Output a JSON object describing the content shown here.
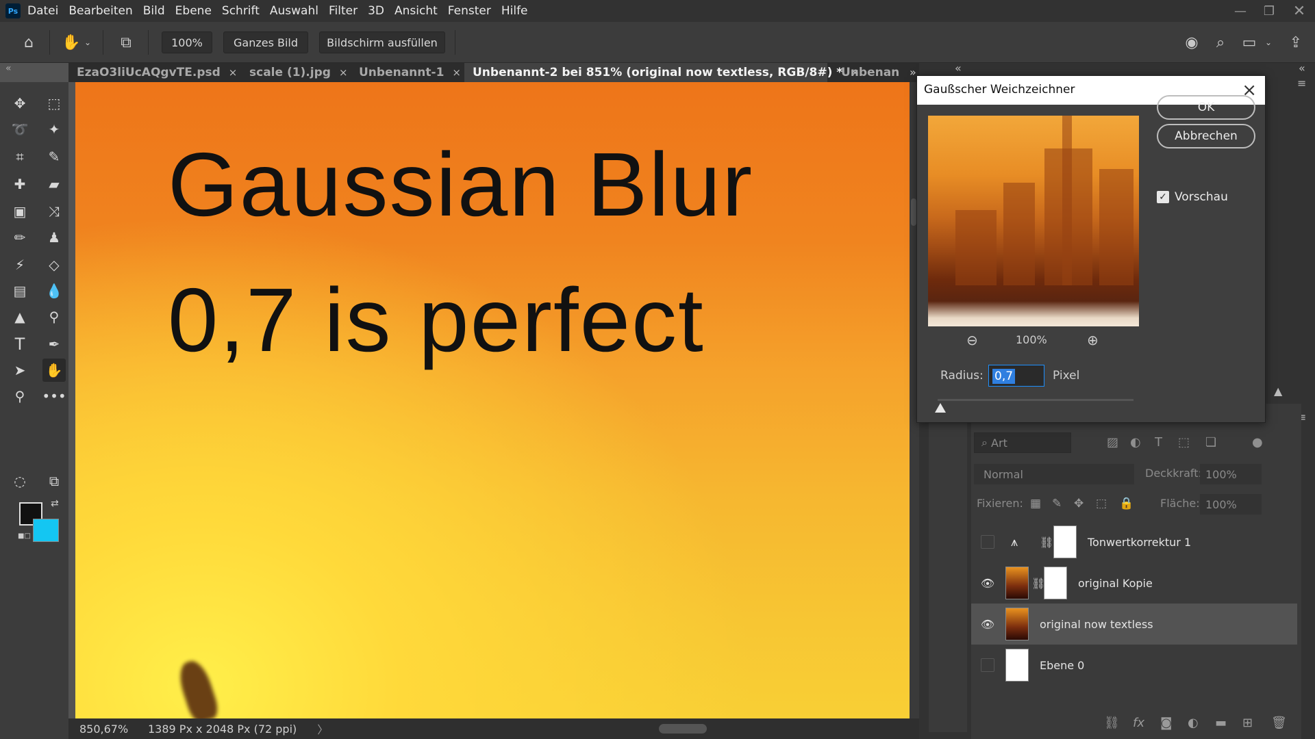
{
  "app": {
    "logo": "Ps"
  },
  "menu": [
    "Datei",
    "Bearbeiten",
    "Bild",
    "Ebene",
    "Schrift",
    "Auswahl",
    "Filter",
    "3D",
    "Ansicht",
    "Fenster",
    "Hilfe"
  ],
  "options": {
    "zoom": "100%",
    "fit_screen": "Ganzes Bild",
    "fill_screen": "Bildschirm ausfüllen"
  },
  "tabs": [
    {
      "label": "EzaO3liUcAQgvTE.psd",
      "close": "×"
    },
    {
      "label": "scale (1).jpg",
      "close": "×"
    },
    {
      "label": "Unbenannt-1",
      "close": "×"
    },
    {
      "label": "Unbenannt-2 bei 851% (original now textless, RGB/8#) *",
      "close": "×"
    },
    {
      "label": "Unbenan",
      "close": ""
    }
  ],
  "canvas": {
    "line1": "Gaussian Blur",
    "line2": "0,7 is perfect"
  },
  "status": {
    "zoom": "850,67%",
    "doc_size": "1389 Px x 2048 Px (72 ppi)",
    "arrow": "〉"
  },
  "colors": {
    "foreground": "#111111",
    "background": "#14c6f2",
    "accent": "#1e90ff"
  },
  "dialog": {
    "title": "Gaußscher Weichzeichner",
    "ok": "OK",
    "cancel": "Abbrechen",
    "preview_label": "Vorschau",
    "preview_zoom": "100%",
    "radius_label": "Radius:",
    "radius_value": "0,7",
    "radius_unit": "Pixel"
  },
  "layers_panel": {
    "filter_kind": "Art",
    "blend_mode": "Normal",
    "opacity_label": "Deckkraft:",
    "opacity_value": "100%",
    "lock_label": "Fixieren:",
    "fill_label": "Fläche:",
    "fill_value": "100%",
    "layers": [
      {
        "name": "Tonwertkorrektur 1",
        "visible": false
      },
      {
        "name": "original Kopie",
        "visible": true
      },
      {
        "name": "original now textless",
        "visible": true,
        "selected": true
      },
      {
        "name": "Ebene 0",
        "visible": false
      }
    ]
  }
}
